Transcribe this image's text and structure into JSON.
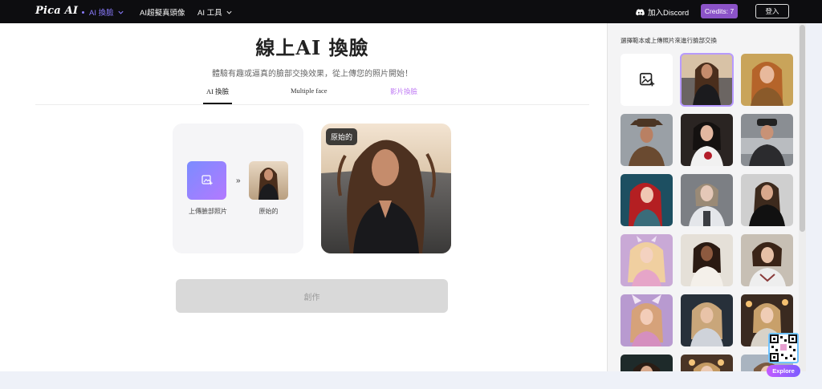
{
  "nav": {
    "logo": "Pica AI",
    "items": [
      {
        "label": "AI 換臉",
        "active": true
      },
      {
        "label": "AI超擬真頭像",
        "active": false
      },
      {
        "label": "AI 工具",
        "active": false
      }
    ],
    "discord_label": "加入Discord",
    "credits_label": "Credits: 7",
    "login_label": "登入"
  },
  "main": {
    "title": "線上AI 換臉",
    "subtitle": "體驗有趣或逼真的臉部交換效果，從上傳您的照片開始！",
    "tabs": [
      {
        "label": "AI 換臉",
        "active": true
      },
      {
        "label": "Multiple face",
        "active": false
      },
      {
        "label": "影片換臉",
        "active": false
      }
    ],
    "upload_label": "上傳臉部照片",
    "arrow": "»",
    "original_label": "原始的",
    "preview_tag": "原始的",
    "create_button": "創作"
  },
  "right_panel": {
    "title": "選擇範本或上傳照片來進行臉部交換",
    "templates_count_visible": 17
  },
  "floating": {
    "explore_label": "Explore"
  },
  "colors": {
    "nav_bg": "#0d0d10",
    "accent_purple": "#8b53c8",
    "nav_active": "#8b7cff",
    "selected_outline": "#b79aff",
    "create_disabled": "#d9d9d9"
  }
}
